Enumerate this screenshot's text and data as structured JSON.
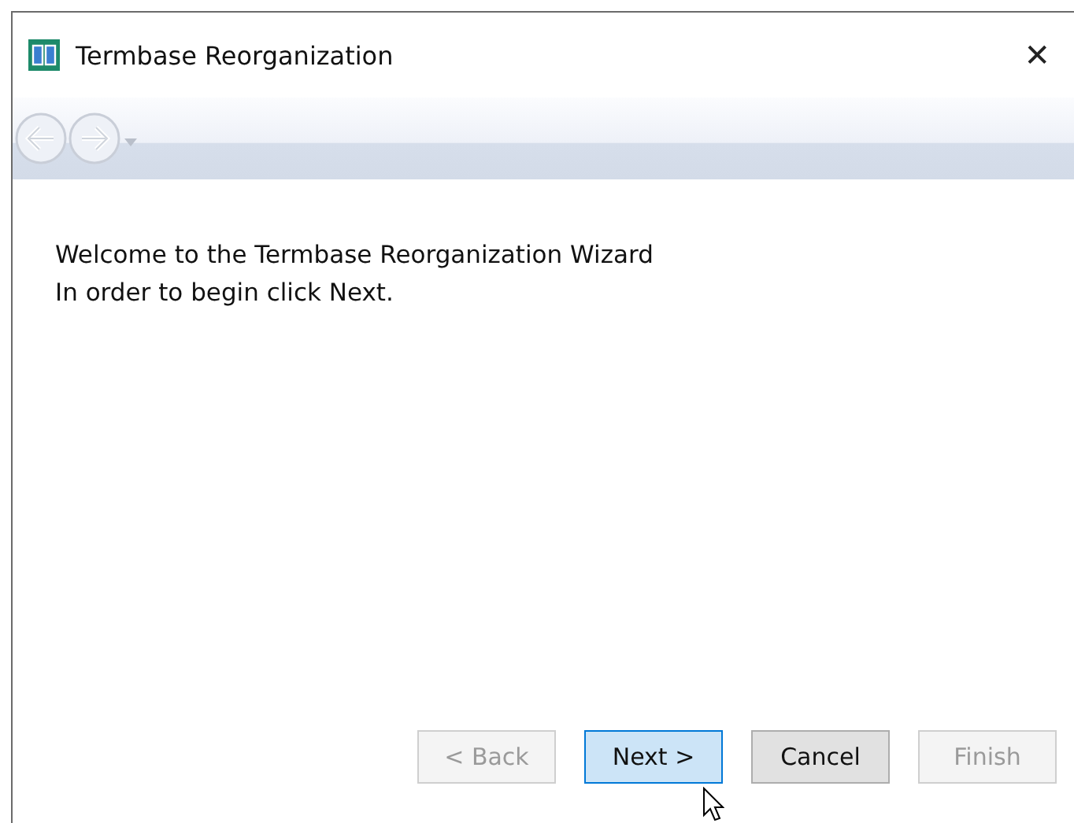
{
  "window": {
    "title": "Termbase Reorganization",
    "close": "✕"
  },
  "nav": {
    "back_enabled": false,
    "forward_enabled": false
  },
  "content": {
    "lines": [
      "Welcome to the Termbase Reorganization Wizard",
      "In order to begin click Next."
    ]
  },
  "buttons": [
    {
      "label": "< Back",
      "disabled": true,
      "highlighted": false
    },
    {
      "label": "Next >",
      "disabled": false,
      "highlighted": true
    },
    {
      "label": "Cancel",
      "disabled": false,
      "highlighted": false
    },
    {
      "label": "Finish",
      "disabled": true,
      "highlighted": false
    }
  ]
}
